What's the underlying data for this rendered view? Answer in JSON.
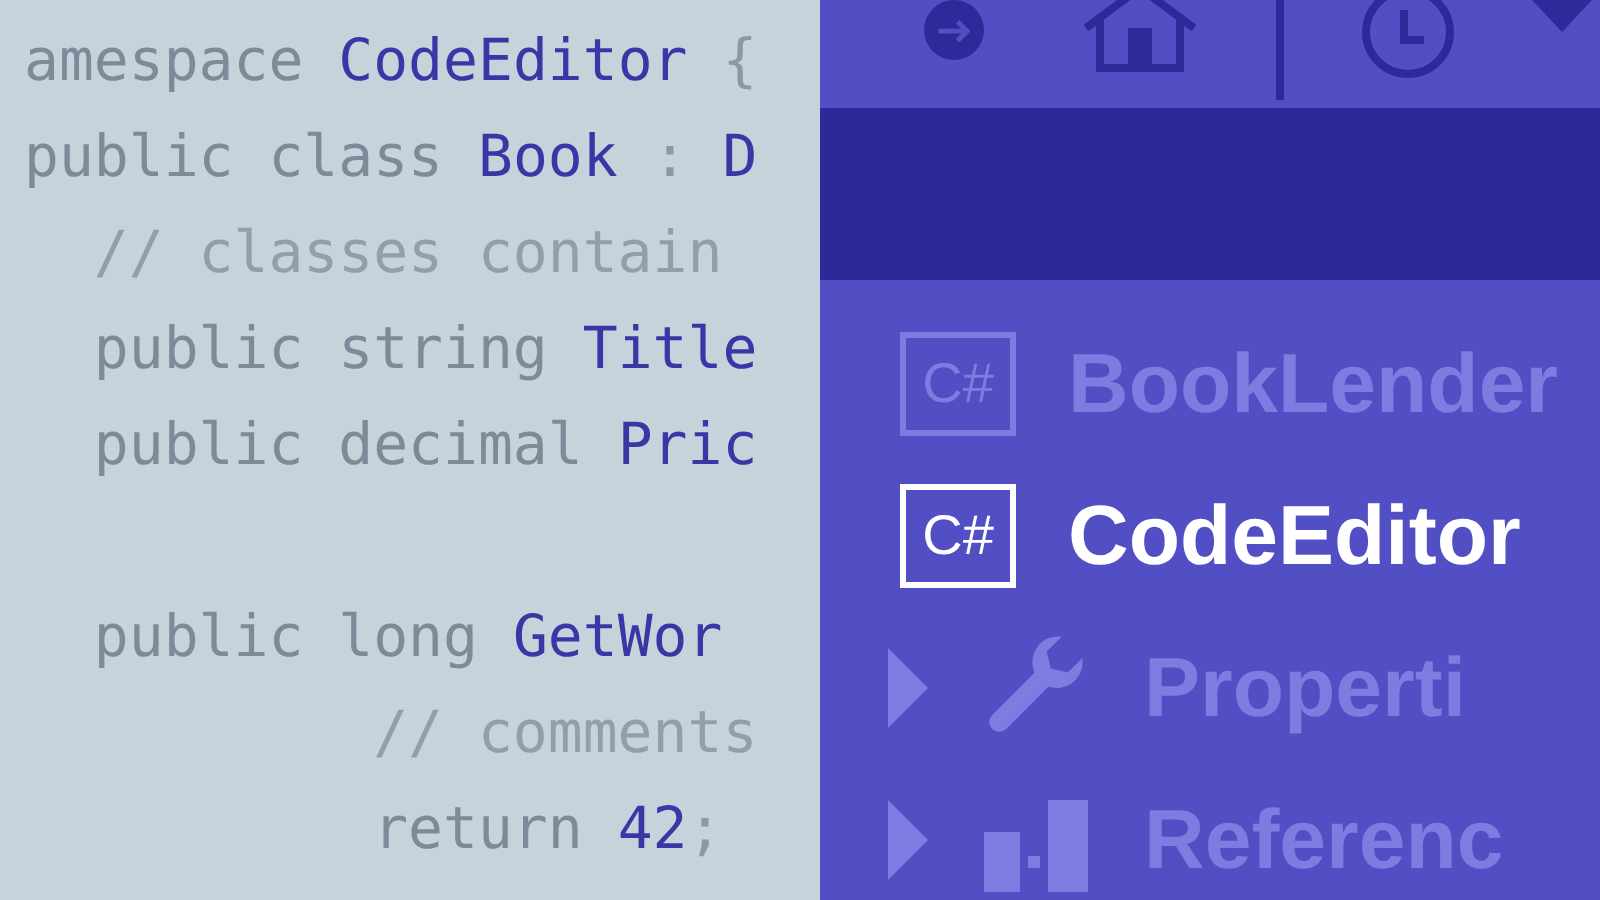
{
  "editor": {
    "lines": [
      {
        "tokens": [
          {
            "kind": "keyword",
            "text": "amespace "
          },
          {
            "kind": "identifier",
            "text": "CodeEditor"
          },
          {
            "kind": "punct",
            "text": " {"
          }
        ]
      },
      {
        "tokens": [
          {
            "kind": "keyword",
            "text": "public class "
          },
          {
            "kind": "identifier",
            "text": "Book"
          },
          {
            "kind": "punct",
            "text": " : "
          },
          {
            "kind": "identifier",
            "text": "D"
          }
        ]
      },
      {
        "tokens": [
          {
            "kind": "comment",
            "text": "  // classes contain"
          }
        ]
      },
      {
        "tokens": [
          {
            "kind": "keyword",
            "text": "  public string "
          },
          {
            "kind": "identifier",
            "text": "Title"
          }
        ]
      },
      {
        "tokens": [
          {
            "kind": "keyword",
            "text": "  public decimal "
          },
          {
            "kind": "identifier",
            "text": "Pric"
          }
        ]
      },
      {
        "blank_line_before": true,
        "tokens": [
          {
            "kind": "keyword",
            "text": "  public long "
          },
          {
            "kind": "identifier",
            "text": "GetWor"
          }
        ]
      },
      {
        "tokens": [
          {
            "kind": "comment",
            "text": "          // comments"
          }
        ]
      },
      {
        "tokens": [
          {
            "kind": "keyword",
            "text": "          return "
          },
          {
            "kind": "identifier",
            "text": "42"
          },
          {
            "kind": "punct",
            "text": ";"
          }
        ]
      }
    ]
  },
  "solution_explorer": {
    "items": [
      {
        "kind": "project",
        "badge": "C#",
        "label": "BookLender",
        "selected": false
      },
      {
        "kind": "project",
        "badge": "C#",
        "label": "CodeEditor",
        "selected": true
      },
      {
        "kind": "properties",
        "label": "Properti",
        "selected": false,
        "expanded": false
      },
      {
        "kind": "references",
        "label": "Referenc",
        "selected": false,
        "expanded": false
      }
    ]
  }
}
